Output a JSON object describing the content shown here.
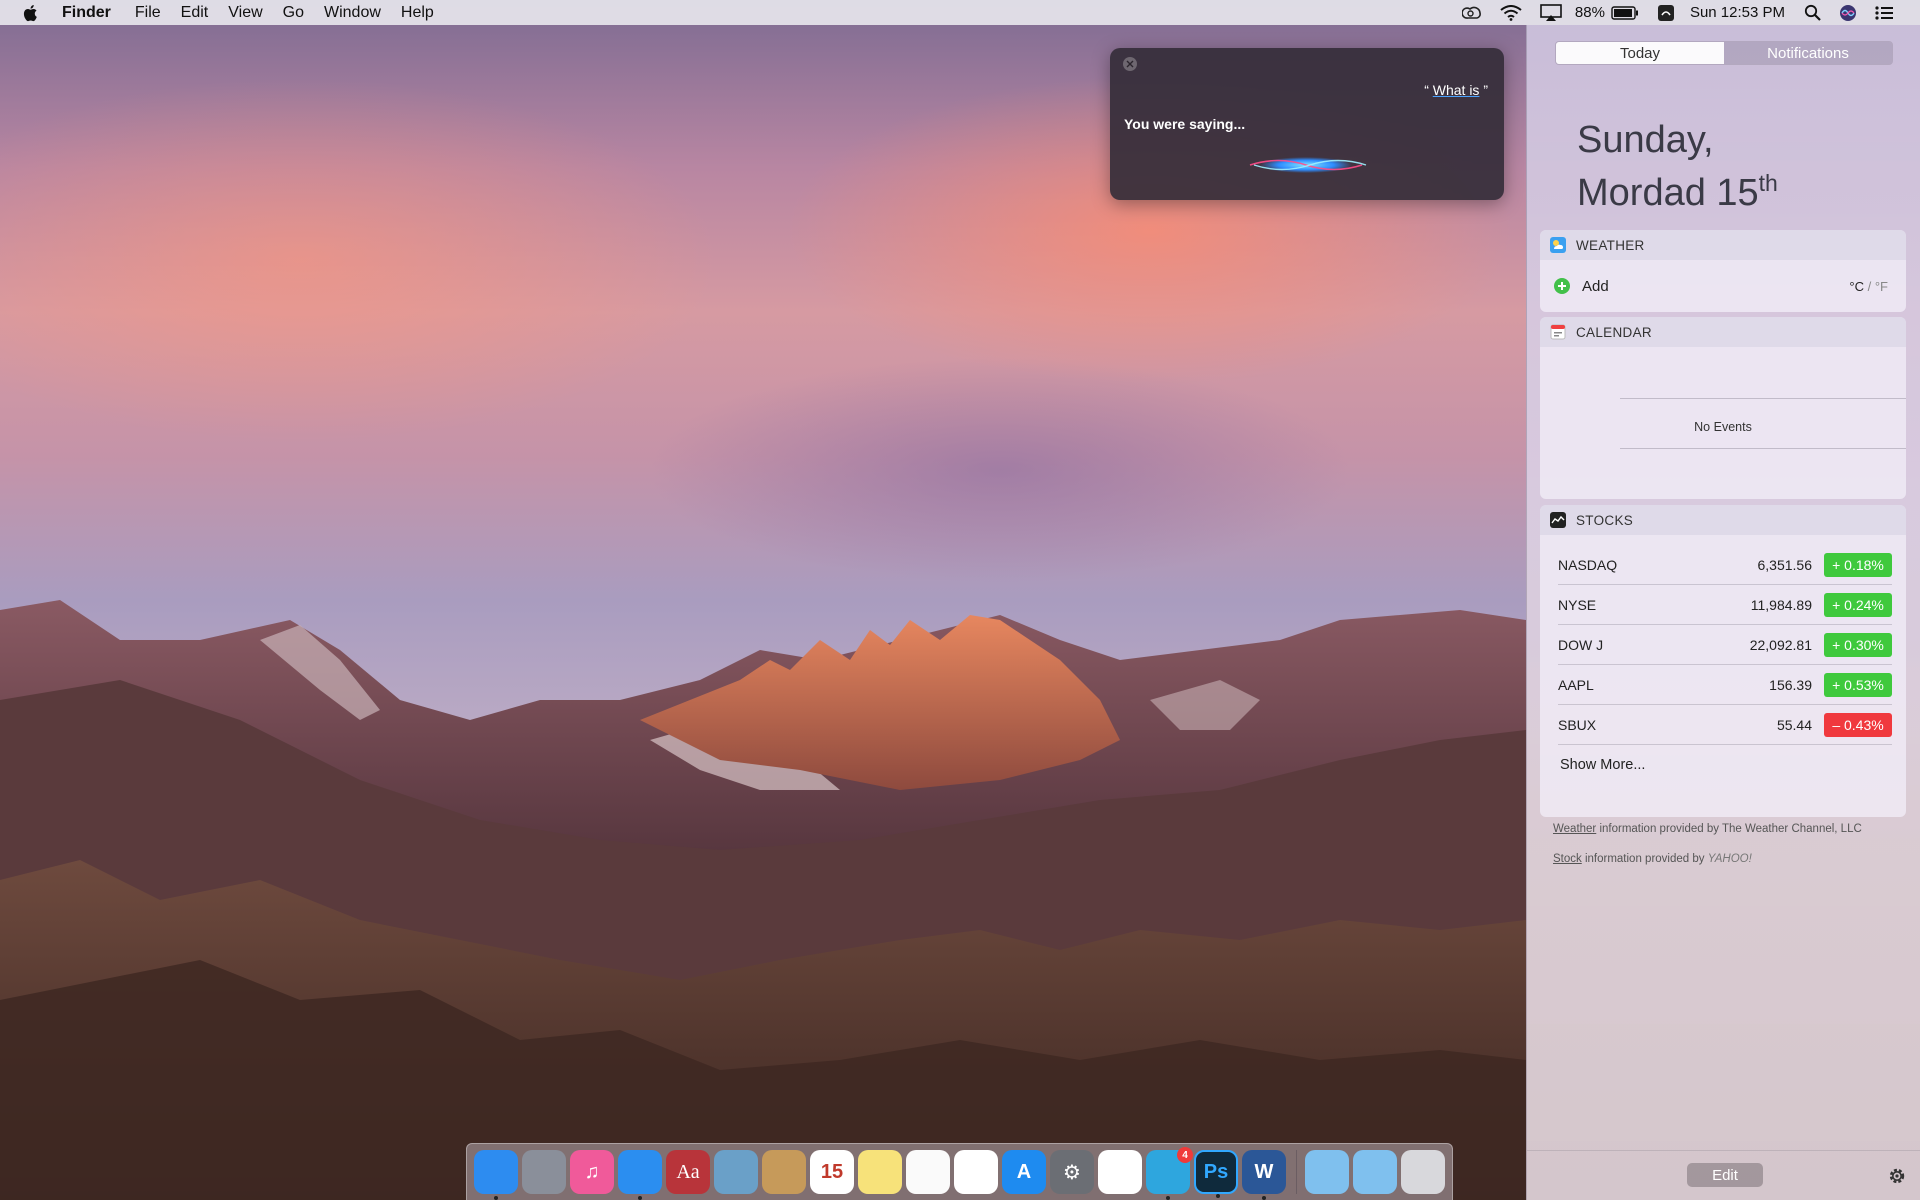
{
  "menubar": {
    "app_name": "Finder",
    "menus": [
      "File",
      "Edit",
      "View",
      "Go",
      "Window",
      "Help"
    ],
    "battery": "88%",
    "clock": "Sun 12:53 PM"
  },
  "siri": {
    "query": "“ What is ”",
    "query_prefix": "“ ",
    "query_word": "What is",
    "query_suffix": " ”",
    "prompt": "You were saying..."
  },
  "notification_center": {
    "tabs": [
      "Today",
      "Notifications"
    ],
    "active_tab": "Today",
    "date_line1": "Sunday,",
    "date_line2": "Mordad 15",
    "date_suffix": "th",
    "weather": {
      "title": "WEATHER",
      "add_label": "Add",
      "unit_c": "°C",
      "unit_sep": " / ",
      "unit_f": "°F"
    },
    "calendar": {
      "title": "CALENDAR",
      "empty_label": "No Events"
    },
    "stocks": {
      "title": "STOCKS",
      "rows": [
        {
          "symbol": "NASDAQ",
          "price": "6,351.56",
          "change": "+ 0.18%",
          "direction": "up"
        },
        {
          "symbol": "NYSE",
          "price": "11,984.89",
          "change": "+ 0.24%",
          "direction": "up"
        },
        {
          "symbol": "DOW J",
          "price": "22,092.81",
          "change": "+ 0.30%",
          "direction": "up"
        },
        {
          "symbol": "AAPL",
          "price": "156.39",
          "change": "+ 0.53%",
          "direction": "up"
        },
        {
          "symbol": "SBUX",
          "price": "55.44",
          "change": "– 0.43%",
          "direction": "down"
        }
      ],
      "show_more": "Show More..."
    },
    "credits": {
      "weather_link": "Weather",
      "weather_text": " information provided by The Weather Channel, LLC",
      "stock_link": "Stock",
      "stock_text": " information provided by ",
      "stock_provider": "YAHOO!"
    },
    "edit_label": "Edit"
  },
  "dock": {
    "apps": [
      {
        "name": "finder",
        "icon": "finder-icon",
        "label": "",
        "color": "#2d8cf0",
        "running": true
      },
      {
        "name": "launchpad",
        "icon": "rocket-icon",
        "label": "",
        "color": "#8a8f9a",
        "running": false
      },
      {
        "name": "itunes",
        "icon": "music-note-icon",
        "label": "♫",
        "color": "#f05a9a",
        "running": false
      },
      {
        "name": "safari",
        "icon": "compass-icon",
        "label": "",
        "color": "#2b8ef0",
        "running": true
      },
      {
        "name": "dictionary",
        "icon": "dictionary-icon",
        "label": "Aa",
        "color": "#b8343a",
        "running": false
      },
      {
        "name": "preview",
        "icon": "preview-icon",
        "label": "",
        "color": "#6aa0c8",
        "running": false
      },
      {
        "name": "contacts",
        "icon": "contacts-icon",
        "label": "",
        "color": "#c69a5a",
        "running": false
      },
      {
        "name": "calendar",
        "icon": "calendar-icon",
        "label": "15",
        "color": "#ffffff",
        "running": false
      },
      {
        "name": "notes",
        "icon": "notes-icon",
        "label": "",
        "color": "#f7e27a",
        "running": false
      },
      {
        "name": "reminders",
        "icon": "reminders-icon",
        "label": "",
        "color": "#fafafa",
        "running": false
      },
      {
        "name": "photos",
        "icon": "photos-icon",
        "label": "",
        "color": "#ffffff",
        "running": false
      },
      {
        "name": "app-store",
        "icon": "app-store-icon",
        "label": "A",
        "color": "#1e8bf0",
        "running": false
      },
      {
        "name": "system-preferences",
        "icon": "gear-icon",
        "label": "⚙",
        "color": "#6b6e74",
        "running": false
      },
      {
        "name": "chrome",
        "icon": "chrome-icon",
        "label": "",
        "color": "#ffffff",
        "running": false
      },
      {
        "name": "telegram",
        "icon": "telegram-icon",
        "label": "",
        "color": "#2ea6de",
        "running": true,
        "badge": "4"
      },
      {
        "name": "photoshop",
        "icon": "photoshop-icon",
        "label": "Ps",
        "color": "#0f2a3c",
        "running": true
      },
      {
        "name": "word",
        "icon": "word-icon",
        "label": "W",
        "color": "#2b5797",
        "running": true
      },
      {
        "name": "applications-folder",
        "icon": "folder-icon",
        "label": "",
        "color": "#7fc0ee",
        "running": false
      },
      {
        "name": "downloads-folder",
        "icon": "folder-download-icon",
        "label": "",
        "color": "#7fc0ee",
        "running": false
      },
      {
        "name": "trash",
        "icon": "trash-icon",
        "label": "",
        "color": "#d8d8dc",
        "running": false
      }
    ]
  }
}
